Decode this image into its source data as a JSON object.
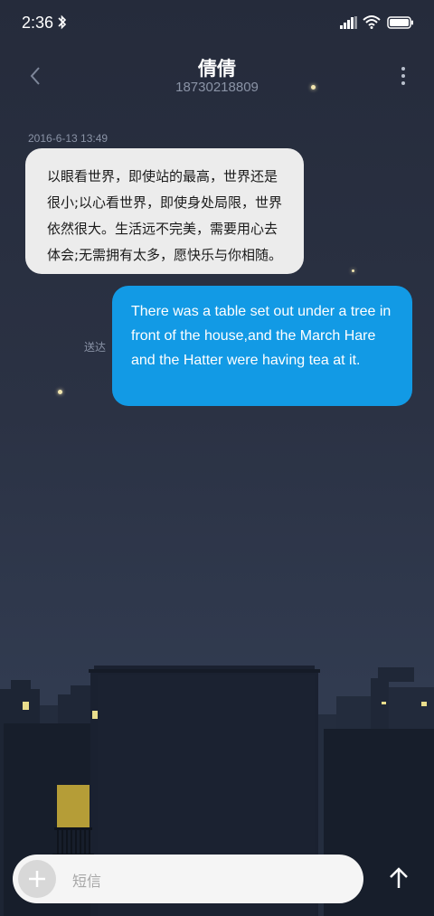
{
  "status_bar": {
    "time": "2:36"
  },
  "header": {
    "contact_name": "倩倩",
    "contact_number": "18730218809"
  },
  "conversation": {
    "timestamp": "2016-6-13 13:49",
    "incoming_message": "以眼看世界，即使站的最高，世界还是很小;以心看世界，即使身处局限，世界依然很大。生活远不完美，需要用心去体会;无需拥有太多，愿快乐与你相随。",
    "outgoing_message": "There was a table set out under a tree in front of the house,and the March Hare and the Hatter were having tea at it.",
    "outgoing_status": "送达"
  },
  "composer": {
    "placeholder": "短信"
  },
  "icons": {
    "status": [
      "bluetooth-icon",
      "signal-icon",
      "wifi-icon",
      "battery-icon"
    ],
    "header": [
      "back-icon",
      "more-icon"
    ],
    "composer": [
      "plus-icon",
      "send-arrow-icon"
    ]
  },
  "colors": {
    "outgoing_bubble": "#129ae5",
    "incoming_bubble": "#ececec",
    "background_top": "#252b3b",
    "background_bottom": "#2f394d"
  }
}
